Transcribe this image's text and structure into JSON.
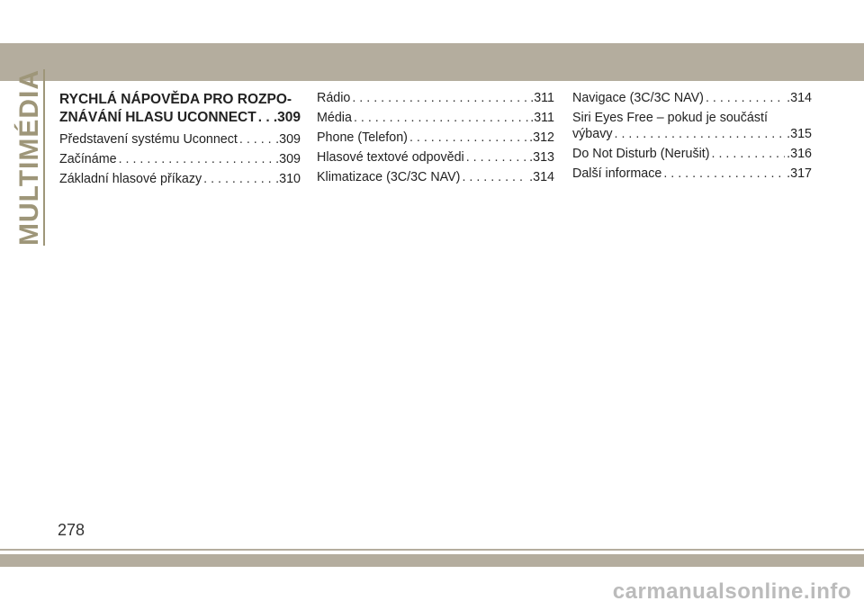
{
  "side_title": "MULTIMÉDIA",
  "page_number": "278",
  "watermark": "carmanualsonline.info",
  "colors": {
    "band": "#b4ad9e",
    "side_title": "#9e9679"
  },
  "col1": {
    "heading_line1": "RYCHLÁ NÁPOVĚDA PRO ROZPO-",
    "heading_line2": "ZNÁVÁNÍ HLASU UCONNECT",
    "heading_page": ".309",
    "entries": [
      {
        "label": "Představení systému Uconnect",
        "page": ".309"
      },
      {
        "label": "Začínáme",
        "page": ".309"
      },
      {
        "label": "Základní hlasové příkazy",
        "page": ".310"
      }
    ]
  },
  "col2": {
    "entries": [
      {
        "label": "Rádio",
        "page": ".311"
      },
      {
        "label": "Média",
        "page": ".311"
      },
      {
        "label": "Phone (Telefon)",
        "page": ".312"
      },
      {
        "label": "Hlasové textové odpovědi",
        "page": ".313"
      },
      {
        "label": "Klimatizace (3C/3C NAV)",
        "page": ".314"
      }
    ]
  },
  "col3": {
    "entries": [
      {
        "label": "Navigace (3C/3C NAV)",
        "page": ".314"
      },
      {
        "label_line1": "Siri Eyes Free – pokud je součástí",
        "label": "výbavy",
        "page": ".315"
      },
      {
        "label": "Do Not Disturb (Nerušit)",
        "page": ".316"
      },
      {
        "label": "Další informace",
        "page": ".317"
      }
    ]
  }
}
